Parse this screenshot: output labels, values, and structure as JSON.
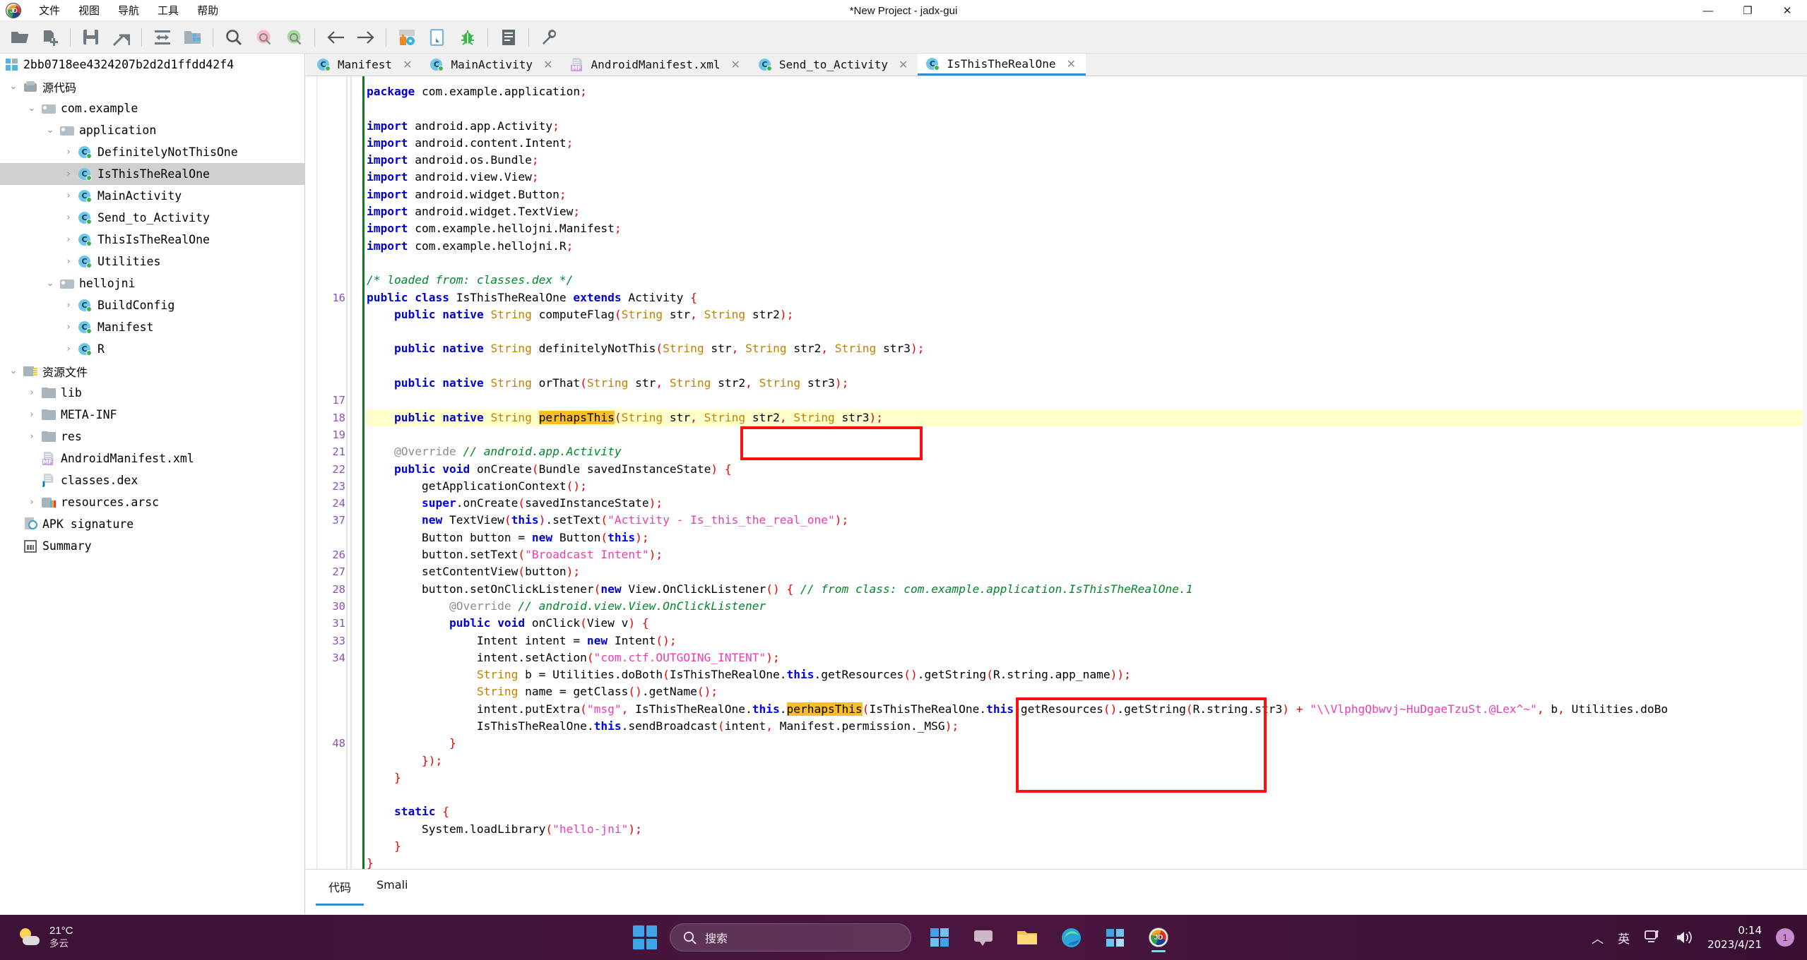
{
  "window": {
    "title": "*New Project - jadx-gui",
    "app_icon": "jadx-logo-icon",
    "minimize": "—",
    "maximize": "❐",
    "close": "✕"
  },
  "menubar": {
    "items": [
      {
        "label": "文件",
        "name": "menu-file"
      },
      {
        "label": "视图",
        "name": "menu-view"
      },
      {
        "label": "导航",
        "name": "menu-navigation"
      },
      {
        "label": "工具",
        "name": "menu-tools"
      },
      {
        "label": "帮助",
        "name": "menu-help"
      }
    ]
  },
  "toolbar": {
    "buttons": [
      {
        "icon": "open-folder-icon"
      },
      {
        "icon": "add-files-icon"
      },
      {
        "sep": true
      },
      {
        "icon": "save-icon"
      },
      {
        "icon": "save-all-export-icon"
      },
      {
        "sep": true
      },
      {
        "icon": "sync-expand-icon"
      },
      {
        "icon": "open-project-icon"
      },
      {
        "sep": true
      },
      {
        "icon": "search-icon"
      },
      {
        "icon": "search-decompiled-pink-icon"
      },
      {
        "icon": "search-resources-green-icon"
      },
      {
        "sep": true
      },
      {
        "icon": "back-arrow-icon"
      },
      {
        "icon": "forward-arrow-icon"
      },
      {
        "sep": true
      },
      {
        "icon": "deobfuscation-icon"
      },
      {
        "icon": "quark-icon"
      },
      {
        "icon": "debugger-bug-icon"
      },
      {
        "sep": true
      },
      {
        "icon": "logs-icon"
      },
      {
        "sep": true
      },
      {
        "icon": "preferences-wrench-icon"
      }
    ]
  },
  "sidebar": {
    "root": {
      "label": "2bb0718ee4324207b2d2d1ffdd42f4",
      "icon": "apk-icon"
    },
    "items": [
      {
        "label": "源代码",
        "icon": "box-icon",
        "indent": 1,
        "arrow": "open",
        "cjk": true
      },
      {
        "label": "com.example",
        "icon": "package-icon",
        "indent": 2,
        "arrow": "open"
      },
      {
        "label": "application",
        "icon": "package-icon",
        "indent": 3,
        "arrow": "open"
      },
      {
        "label": "DefinitelyNotThisOne",
        "icon": "class-icon",
        "indent": 4,
        "arrow": "closed"
      },
      {
        "label": "IsThisTheRealOne",
        "icon": "class-icon",
        "indent": 4,
        "arrow": "closed",
        "selected": true
      },
      {
        "label": "MainActivity",
        "icon": "class-icon",
        "indent": 4,
        "arrow": "closed"
      },
      {
        "label": "Send_to_Activity",
        "icon": "class-icon",
        "indent": 4,
        "arrow": "closed"
      },
      {
        "label": "ThisIsTheRealOne",
        "icon": "class-icon",
        "indent": 4,
        "arrow": "closed"
      },
      {
        "label": "Utilities",
        "icon": "class-icon",
        "indent": 4,
        "arrow": "closed"
      },
      {
        "label": "hellojni",
        "icon": "package-icon",
        "indent": 3,
        "arrow": "open"
      },
      {
        "label": "BuildConfig",
        "icon": "class-icon",
        "indent": 4,
        "arrow": "closed"
      },
      {
        "label": "Manifest",
        "icon": "class-icon",
        "indent": 4,
        "arrow": "closed"
      },
      {
        "label": "R",
        "icon": "class-icon",
        "indent": 4,
        "arrow": "closed"
      },
      {
        "label": "资源文件",
        "icon": "res-folder-icon",
        "indent": 1,
        "arrow": "open",
        "cjk": true
      },
      {
        "label": "lib",
        "icon": "folder-icon",
        "indent": 2,
        "arrow": "closed"
      },
      {
        "label": "META-INF",
        "icon": "folder-icon",
        "indent": 2,
        "arrow": "closed"
      },
      {
        "label": "res",
        "icon": "folder-icon",
        "indent": 2,
        "arrow": "closed"
      },
      {
        "label": "AndroidManifest.xml",
        "icon": "xml-mf-icon",
        "indent": 2,
        "arrow": "none"
      },
      {
        "label": "classes.dex",
        "icon": "dex-j-icon",
        "indent": 2,
        "arrow": "none"
      },
      {
        "label": "resources.arsc",
        "icon": "arsc-icon",
        "indent": 2,
        "arrow": "closed"
      },
      {
        "label": "APK signature",
        "icon": "signature-icon",
        "indent": 1,
        "arrow": "none"
      },
      {
        "label": "Summary",
        "icon": "summary-icon",
        "indent": 1,
        "arrow": "none"
      }
    ]
  },
  "tabs": [
    {
      "label": "Manifest",
      "icon": "class-icon",
      "active": false
    },
    {
      "label": "MainActivity",
      "icon": "class-icon",
      "active": false
    },
    {
      "label": "AndroidManifest.xml",
      "icon": "xml-mf-icon",
      "active": false
    },
    {
      "label": "Send_to_Activity",
      "icon": "class-icon",
      "active": false
    },
    {
      "label": "IsThisTheRealOne",
      "icon": "class-icon",
      "active": true
    }
  ],
  "tab_close_glyph": "✕",
  "editor": {
    "line_numbers": [
      "",
      "",
      "",
      "",
      "",
      "",
      "",
      "",
      "",
      "",
      "",
      "",
      "16",
      "",
      "",
      "",
      "",
      "",
      "17",
      "18",
      "19",
      "21",
      "22",
      "23",
      "24",
      "37",
      "",
      "26",
      "27",
      "28",
      "30",
      "31",
      "33",
      "34",
      "",
      "",
      "",
      "",
      "48",
      ""
    ],
    "lines": [
      "package com.example.application;",
      "",
      "import android.app.Activity;",
      "import android.content.Intent;",
      "import android.os.Bundle;",
      "import android.view.View;",
      "import android.widget.Button;",
      "import android.widget.TextView;",
      "import com.example.hellojni.Manifest;",
      "import com.example.hellojni.R;",
      "",
      "/* loaded from: classes.dex */",
      "public class IsThisTheRealOne extends Activity {",
      "    public native String computeFlag(String str, String str2);",
      "",
      "    public native String definitelyNotThis(String str, String str2, String str3);",
      "",
      "    public native String orThat(String str, String str2, String str3);",
      "",
      "    public native String perhapsThis(String str, String str2, String str3);",
      "",
      "    @Override // android.app.Activity",
      "    public void onCreate(Bundle savedInstanceState) {",
      "        getApplicationContext();",
      "        super.onCreate(savedInstanceState);",
      "        new TextView(this).setText(\"Activity - Is_this_the_real_one\");",
      "        Button button = new Button(this);",
      "        button.setText(\"Broadcast Intent\");",
      "        setContentView(button);",
      "        button.setOnClickListener(new View.OnClickListener() { // from class: com.example.application.IsThisTheRealOne.1",
      "            @Override // android.view.View.OnClickListener",
      "            public void onClick(View v) {",
      "                Intent intent = new Intent();",
      "                intent.setAction(\"com.ctf.OUTGOING_INTENT\");",
      "                String b = Utilities.doBoth(IsThisTheRealOne.this.getResources().getString(R.string.app_name));",
      "                String name = getClass().getName();",
      "                intent.putExtra(\"msg\", IsThisTheRealOne.this.perhapsThis(IsThisTheRealOne.this.getResources().getString(R.string.str3) + \"\\\\VlphgQbwvj~HuDgaeTzuSt.@Lex^~\", b, Utilities.doBo",
      "                IsThisTheRealOne.this.sendBroadcast(intent, Manifest.permission._MSG);",
      "            }",
      "        });",
      "    }",
      "",
      "    static {",
      "        System.loadLibrary(\"hello-jni\");",
      "    }",
      "}"
    ],
    "highlighted_token": "perhapsThis",
    "highlight_color": "#fbbe28",
    "highlight_row_color": "#ffffcc",
    "annotation_box_color": "#ff1010"
  },
  "bottom_tabs": [
    {
      "label": "代码",
      "active": true
    },
    {
      "label": "Smali",
      "active": false
    }
  ],
  "taskbar": {
    "weather": {
      "temp": "21°C",
      "desc": "多云"
    },
    "start_icon": "windows-start-icon",
    "search": {
      "icon": "search-icon",
      "placeholder": "搜索"
    },
    "apps": [
      {
        "icon": "widgets-icon",
        "name": "taskbar-widgets"
      },
      {
        "icon": "file-explorer-icon",
        "name": "taskbar-file-explorer"
      },
      {
        "icon": "edge-icon",
        "name": "taskbar-edge"
      },
      {
        "icon": "store-icon",
        "name": "taskbar-store"
      },
      {
        "icon": "jadx-icon",
        "name": "taskbar-jadx",
        "active": true
      }
    ],
    "tray": {
      "chevron": "︿",
      "ime": "英",
      "network": "network-icon",
      "volume": "volume-icon",
      "time": "0:14",
      "date": "2023/4/21",
      "notification_count": "1"
    }
  }
}
